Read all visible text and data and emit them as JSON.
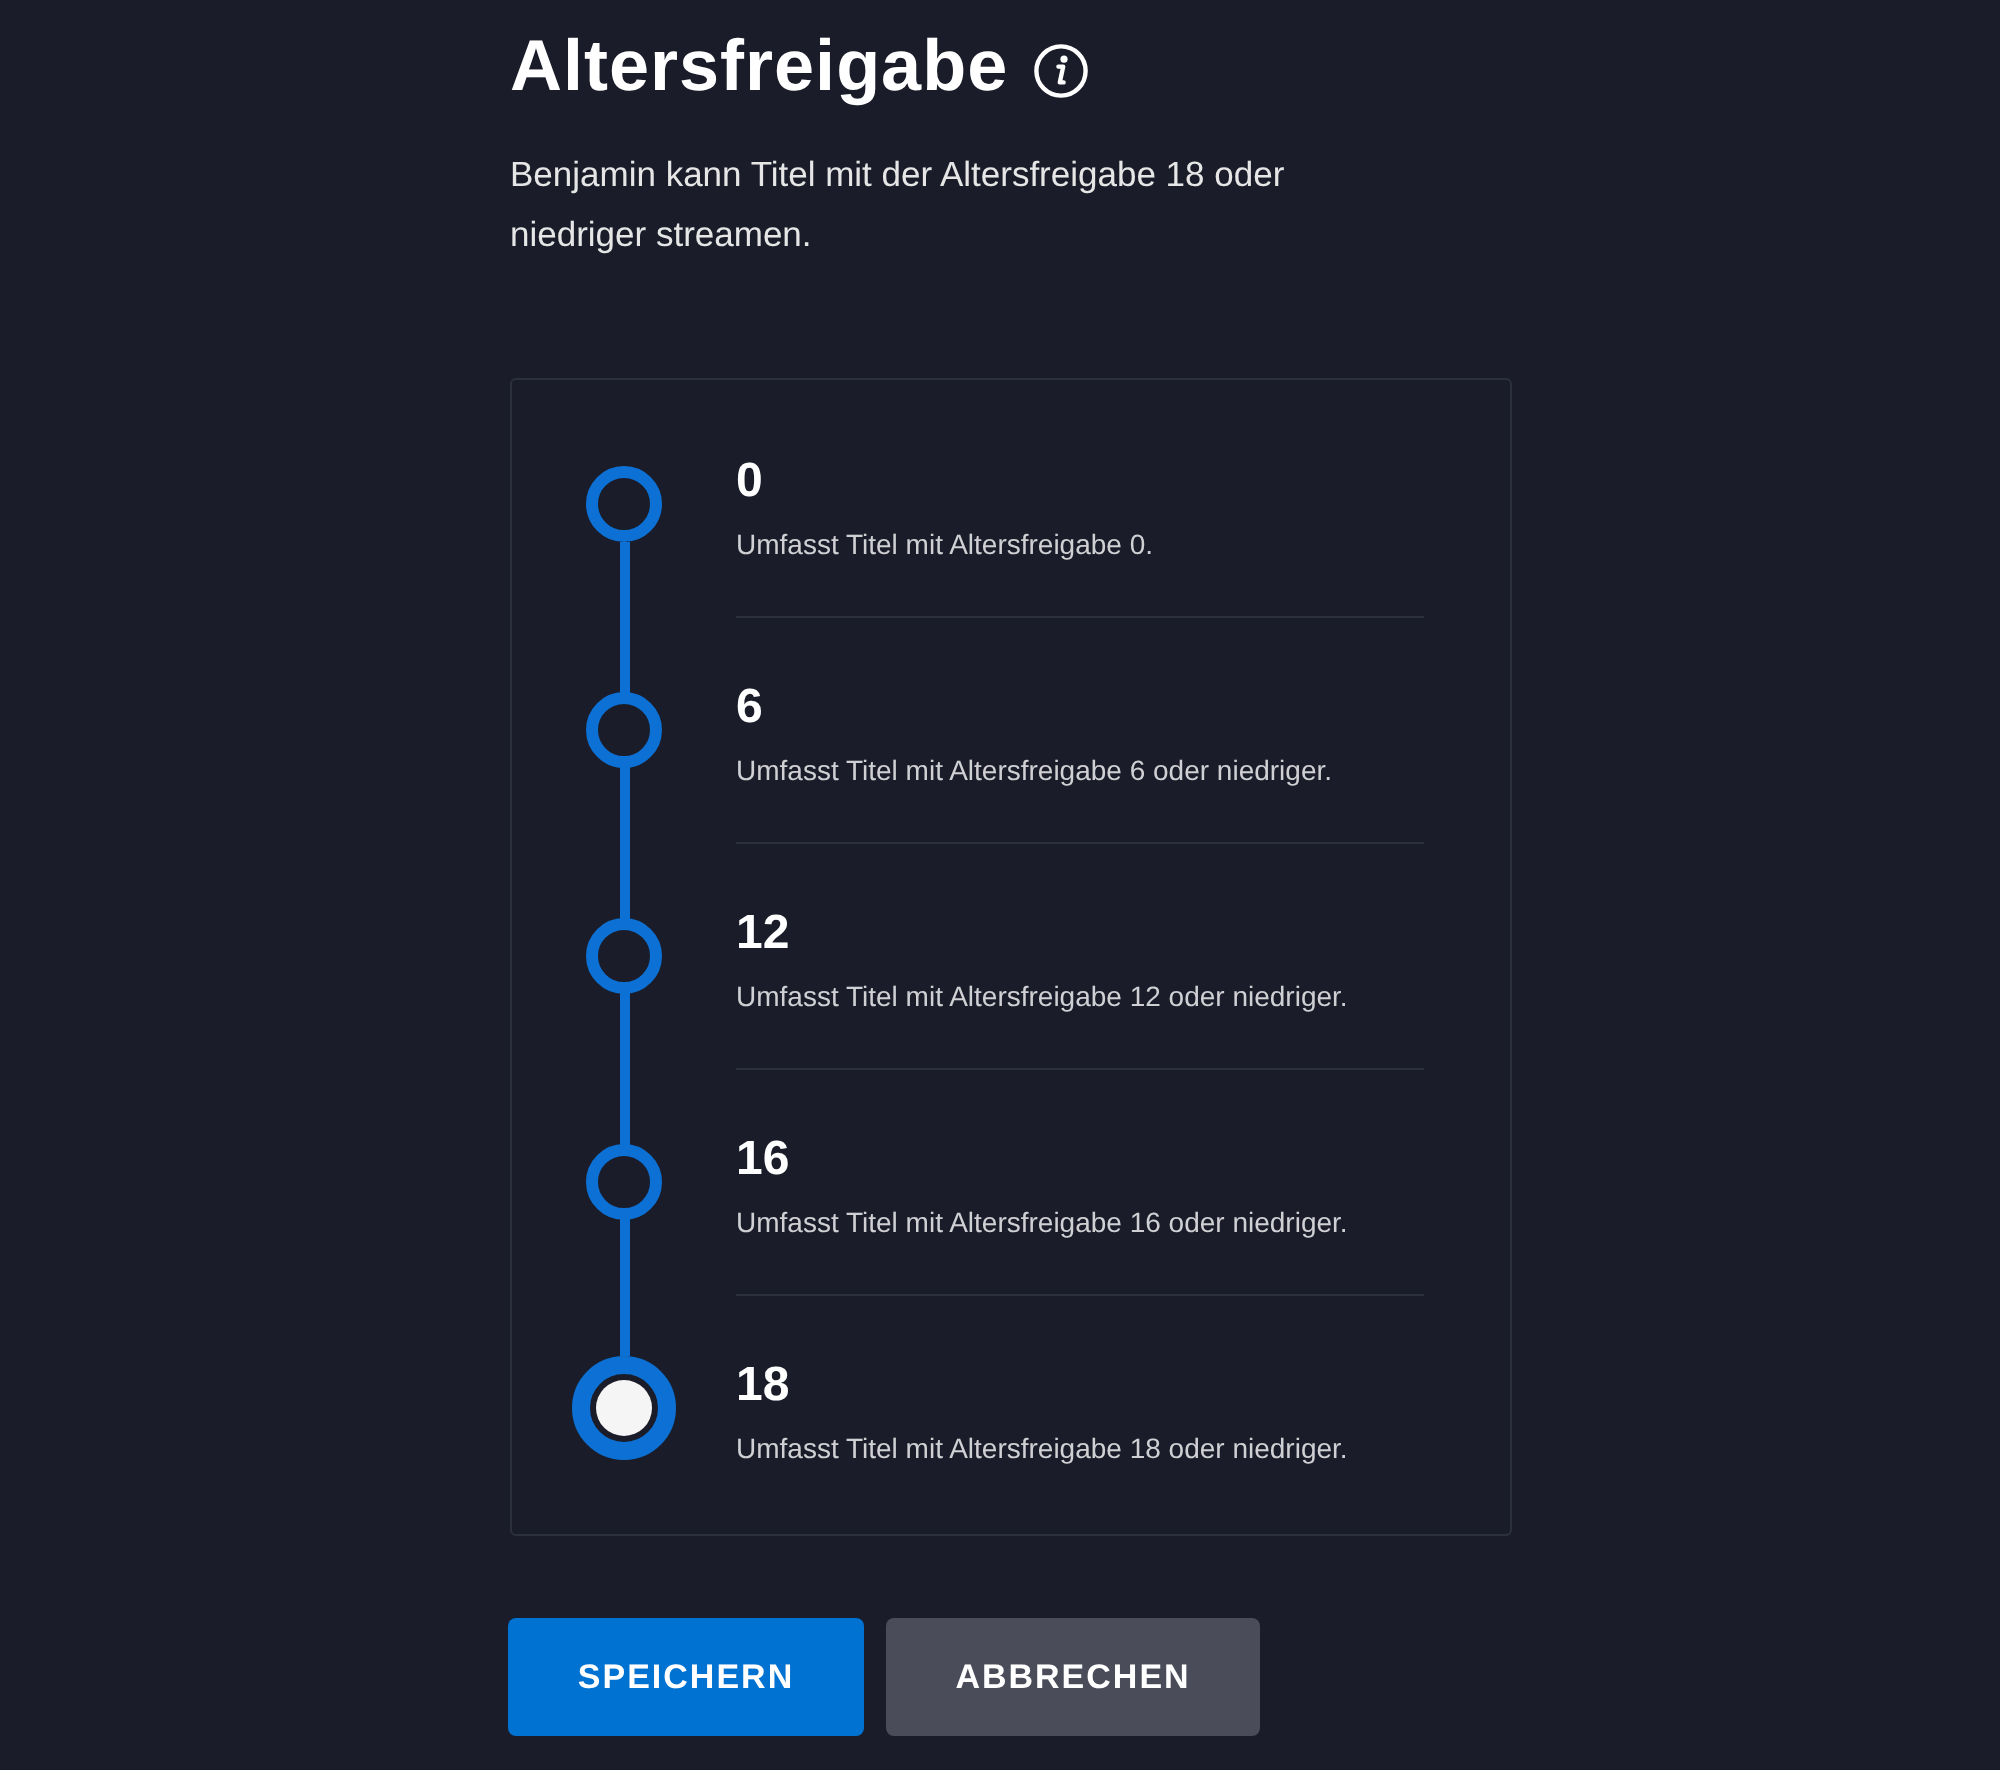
{
  "title": "Altersfreigabe",
  "description": "Benjamin kann Titel mit der Altersfreigabe 18 oder niedriger streamen.",
  "ratings": [
    {
      "label": "0",
      "description": "Umfasst Titel mit Altersfreigabe 0.",
      "selected": false
    },
    {
      "label": "6",
      "description": "Umfasst Titel mit Altersfreigabe 6 oder niedriger.",
      "selected": false
    },
    {
      "label": "12",
      "description": "Umfasst Titel mit Altersfreigabe 12 oder niedriger.",
      "selected": false
    },
    {
      "label": "16",
      "description": "Umfasst Titel mit Altersfreigabe 16 oder niedriger.",
      "selected": false
    },
    {
      "label": "18",
      "description": "Umfasst Titel mit Altersfreigabe 18 oder niedriger.",
      "selected": true
    }
  ],
  "buttons": [
    {
      "label": "SPEICHERN",
      "kind": "primary"
    },
    {
      "label": "ABBRECHEN",
      "kind": "secondary"
    }
  ]
}
